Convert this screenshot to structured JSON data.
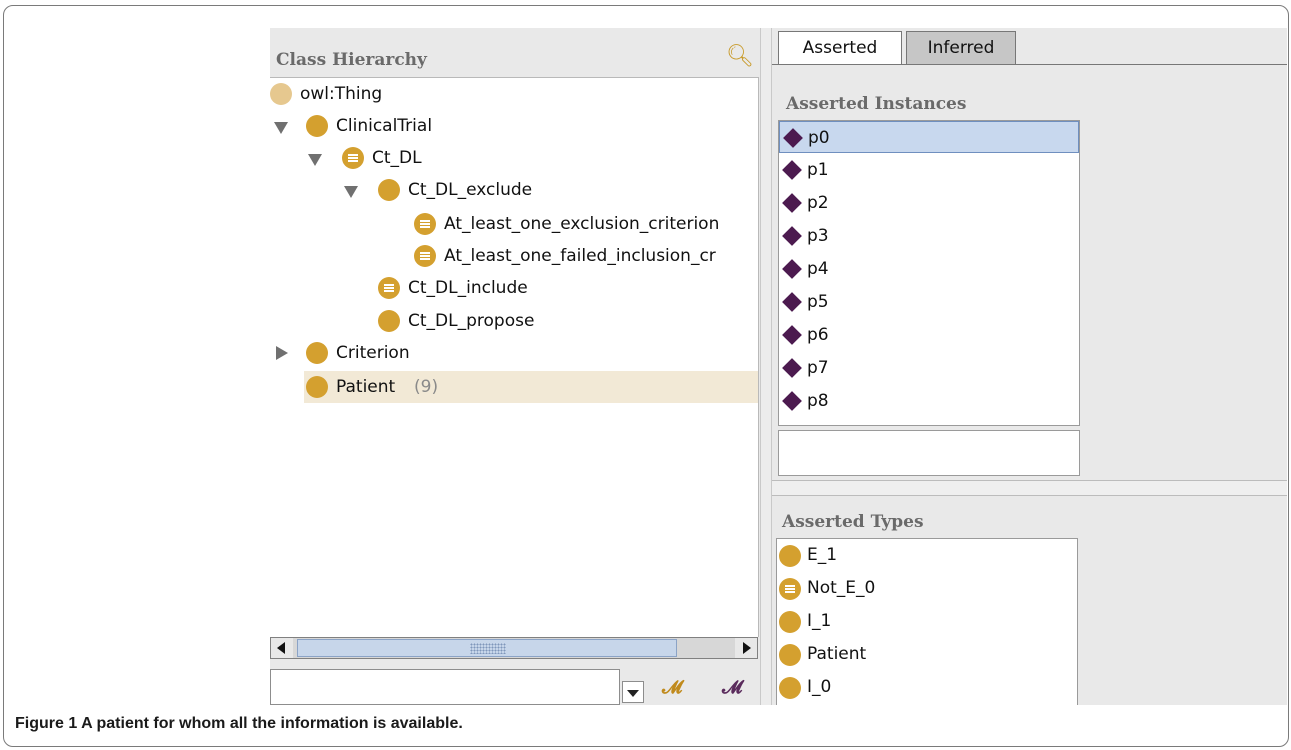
{
  "left_panel": {
    "title": "Class Hierarchy",
    "tree": [
      {
        "label": "owl:Thing",
        "count": ""
      },
      {
        "label": "ClinicalTrial",
        "count": ""
      },
      {
        "label": "Ct_DL",
        "count": ""
      },
      {
        "label": "Ct_DL_exclude",
        "count": ""
      },
      {
        "label": "At_least_one_exclusion_criterion",
        "count": ""
      },
      {
        "label": "At_least_one_failed_inclusion_cr",
        "count": ""
      },
      {
        "label": "Ct_DL_include",
        "count": ""
      },
      {
        "label": "Ct_DL_propose",
        "count": ""
      },
      {
        "label": "Criterion",
        "count": ""
      },
      {
        "label": "Patient",
        "count": "(9)"
      }
    ],
    "search": {
      "value": "",
      "placeholder": ""
    }
  },
  "right_panel": {
    "tabs": [
      {
        "label": "Asserted",
        "active": true
      },
      {
        "label": "Inferred",
        "active": false
      }
    ],
    "instances_title": "Asserted Instances",
    "instances": [
      "p0",
      "p1",
      "p2",
      "p3",
      "p4",
      "p5",
      "p6",
      "p7",
      "p8"
    ],
    "selected_instance": "p0",
    "types_title": "Asserted Types",
    "types": [
      "E_1",
      "Not_E_0",
      "I_1",
      "Patient",
      "I_0"
    ]
  },
  "caption": {
    "label": "Figure 1",
    "text": "A patient for whom all the information is available."
  },
  "colors": {
    "class_icon": "#d4a02f",
    "individual_icon": "#4c1a4f",
    "selection": "#c8d8ee"
  }
}
